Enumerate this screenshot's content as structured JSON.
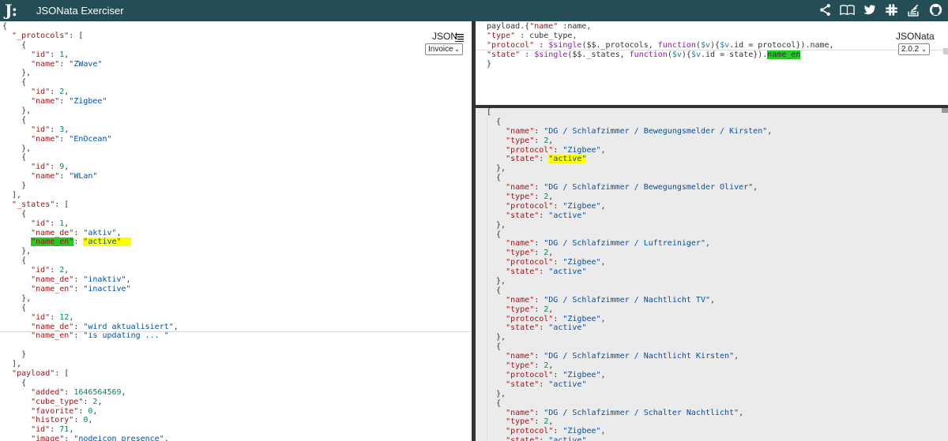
{
  "app": {
    "logo_glyph": "J:",
    "title": "JSONata Exerciser",
    "icons": [
      "share-icon",
      "book-icon",
      "twitter-icon",
      "slack-icon",
      "stackoverflow-icon",
      "github-icon"
    ]
  },
  "input_pane": {
    "label": "JSON",
    "selector": {
      "selected": "Invoice"
    }
  },
  "expression_pane": {
    "label": "JSONata",
    "version_selector": {
      "selected": "2.0.2"
    }
  },
  "input_lines": [
    [
      [
        "p",
        "{"
      ]
    ],
    [
      [
        "p",
        "  "
      ],
      [
        "k",
        "\"_protocols\""
      ],
      [
        "p",
        ": ["
      ]
    ],
    [
      [
        "p",
        "    {"
      ]
    ],
    [
      [
        "p",
        "      "
      ],
      [
        "k",
        "\"id\""
      ],
      [
        "p",
        ": "
      ],
      [
        "n",
        "1"
      ],
      [
        "p",
        ","
      ]
    ],
    [
      [
        "p",
        "      "
      ],
      [
        "k",
        "\"name\""
      ],
      [
        "p",
        ": "
      ],
      [
        "s",
        "\"ZWave\""
      ]
    ],
    [
      [
        "p",
        "    },"
      ]
    ],
    [
      [
        "p",
        "    {"
      ]
    ],
    [
      [
        "p",
        "      "
      ],
      [
        "k",
        "\"id\""
      ],
      [
        "p",
        ": "
      ],
      [
        "n",
        "2"
      ],
      [
        "p",
        ","
      ]
    ],
    [
      [
        "p",
        "      "
      ],
      [
        "k",
        "\"name\""
      ],
      [
        "p",
        ": "
      ],
      [
        "s",
        "\"Zigbee\""
      ]
    ],
    [
      [
        "p",
        "    },"
      ]
    ],
    [
      [
        "p",
        "    {"
      ]
    ],
    [
      [
        "p",
        "      "
      ],
      [
        "k",
        "\"id\""
      ],
      [
        "p",
        ": "
      ],
      [
        "n",
        "3"
      ],
      [
        "p",
        ","
      ]
    ],
    [
      [
        "p",
        "      "
      ],
      [
        "k",
        "\"name\""
      ],
      [
        "p",
        ": "
      ],
      [
        "s",
        "\"EnOcean\""
      ]
    ],
    [
      [
        "p",
        "    },"
      ]
    ],
    [
      [
        "p",
        "    {"
      ]
    ],
    [
      [
        "p",
        "      "
      ],
      [
        "k",
        "\"id\""
      ],
      [
        "p",
        ": "
      ],
      [
        "n",
        "9"
      ],
      [
        "p",
        ","
      ]
    ],
    [
      [
        "p",
        "      "
      ],
      [
        "k",
        "\"name\""
      ],
      [
        "p",
        ": "
      ],
      [
        "s",
        "\"WLan\""
      ]
    ],
    [
      [
        "p",
        "    }"
      ]
    ],
    [
      [
        "p",
        "  ],"
      ]
    ],
    [
      [
        "p",
        "  "
      ],
      [
        "k",
        "\"_states\""
      ],
      [
        "p",
        ": ["
      ]
    ],
    [
      [
        "p",
        "    {"
      ]
    ],
    [
      [
        "p",
        "      "
      ],
      [
        "k",
        "\"id\""
      ],
      [
        "p",
        ": "
      ],
      [
        "n",
        "1"
      ],
      [
        "p",
        ","
      ]
    ],
    [
      [
        "p",
        "      "
      ],
      [
        "k",
        "\"name_de\""
      ],
      [
        "p",
        ": "
      ],
      [
        "s",
        "\"aktiv\""
      ],
      [
        "p",
        ","
      ]
    ],
    [
      [
        "p",
        "      "
      ],
      [
        "k hl-g",
        "\"name_en\""
      ],
      [
        "p",
        ": "
      ],
      [
        "s hl-y",
        "\"active\"  "
      ]
    ],
    [
      [
        "p",
        "    },"
      ]
    ],
    [
      [
        "p",
        "    {"
      ]
    ],
    [
      [
        "p",
        "      "
      ],
      [
        "k",
        "\"id\""
      ],
      [
        "p",
        ": "
      ],
      [
        "n",
        "2"
      ],
      [
        "p",
        ","
      ]
    ],
    [
      [
        "p",
        "      "
      ],
      [
        "k",
        "\"name_de\""
      ],
      [
        "p",
        ": "
      ],
      [
        "s",
        "\"inaktiv\""
      ],
      [
        "p",
        ","
      ]
    ],
    [
      [
        "p",
        "      "
      ],
      [
        "k",
        "\"name_en\""
      ],
      [
        "p",
        ": "
      ],
      [
        "s",
        "\"inactive\""
      ]
    ],
    [
      [
        "p",
        "    },"
      ]
    ],
    [
      [
        "p",
        "    {"
      ]
    ],
    [
      [
        "p",
        "      "
      ],
      [
        "k",
        "\"id\""
      ],
      [
        "p",
        ": "
      ],
      [
        "n",
        "12"
      ],
      [
        "p",
        ","
      ]
    ],
    [
      [
        "p",
        "      "
      ],
      [
        "k",
        "\"name_de\""
      ],
      [
        "p",
        ": "
      ],
      [
        "s",
        "\"wird aktualisiert\""
      ],
      [
        "p",
        ","
      ]
    ],
    [
      [
        "p",
        "      "
      ],
      [
        "k",
        "\"name_en\""
      ],
      [
        "p",
        ": "
      ],
      [
        "s",
        "\"is updating ... \""
      ]
    ],
    [
      [
        "p",
        " "
      ]
    ],
    [
      [
        "p",
        "    }"
      ]
    ],
    [
      [
        "p",
        "  ],"
      ]
    ],
    [
      [
        "p",
        "  "
      ],
      [
        "k",
        "\"payload\""
      ],
      [
        "p",
        ": ["
      ]
    ],
    [
      [
        "p",
        "    {"
      ]
    ],
    [
      [
        "p",
        "      "
      ],
      [
        "k",
        "\"added\""
      ],
      [
        "p",
        ": "
      ],
      [
        "n",
        "1646564569"
      ],
      [
        "p",
        ","
      ]
    ],
    [
      [
        "p",
        "      "
      ],
      [
        "k",
        "\"cube_type\""
      ],
      [
        "p",
        ": "
      ],
      [
        "n",
        "2"
      ],
      [
        "p",
        ","
      ]
    ],
    [
      [
        "p",
        "      "
      ],
      [
        "k",
        "\"favorite\""
      ],
      [
        "p",
        ": "
      ],
      [
        "n",
        "0"
      ],
      [
        "p",
        ","
      ]
    ],
    [
      [
        "p",
        "      "
      ],
      [
        "k",
        "\"history\""
      ],
      [
        "p",
        ": "
      ],
      [
        "n",
        "0"
      ],
      [
        "p",
        ","
      ]
    ],
    [
      [
        "p",
        "      "
      ],
      [
        "k",
        "\"id\""
      ],
      [
        "p",
        ": "
      ],
      [
        "n",
        "71"
      ],
      [
        "p",
        ","
      ]
    ],
    [
      [
        "p",
        "      "
      ],
      [
        "k",
        "\"image\""
      ],
      [
        "p",
        ": "
      ],
      [
        "s",
        "\"nodeicon_presence\""
      ],
      [
        "p",
        ","
      ]
    ]
  ],
  "expression_lines": [
    [
      [
        "p",
        "payload.{"
      ],
      [
        "k",
        "\"name\""
      ],
      [
        "p",
        " :name,"
      ]
    ],
    [
      [
        "k",
        "\"type\""
      ],
      [
        "p",
        " : cube_type,"
      ]
    ],
    [
      [
        "k",
        "\"protocol\""
      ],
      [
        "p",
        " : "
      ],
      [
        "f",
        "$single"
      ],
      [
        "p",
        "($$._protocols, "
      ],
      [
        "f",
        "function"
      ],
      [
        "p",
        "("
      ],
      [
        "v",
        "$v"
      ],
      [
        "p",
        "){"
      ],
      [
        "v",
        "$v"
      ],
      [
        "p",
        ".id = protocol}).name,"
      ]
    ],
    [
      [
        "k",
        "\"state\""
      ],
      [
        "p",
        " : "
      ],
      [
        "f",
        "$single"
      ],
      [
        "p",
        "($$._states, "
      ],
      [
        "f",
        "function"
      ],
      [
        "p",
        "("
      ],
      [
        "v",
        "$v"
      ],
      [
        "p",
        "){"
      ],
      [
        "v",
        "$v"
      ],
      [
        "p",
        ".id = state})."
      ],
      [
        "p hl-g",
        "name_en"
      ],
      [
        "p",
        "  "
      ]
    ],
    [
      [
        "p",
        "}"
      ]
    ]
  ],
  "result_lines": [
    [
      [
        "p",
        "["
      ]
    ],
    [
      [
        "p",
        "  {"
      ]
    ],
    [
      [
        "p",
        "    "
      ],
      [
        "k",
        "\"name\""
      ],
      [
        "p",
        ": "
      ],
      [
        "s",
        "\"DG / Schlafzimmer / Bewegungsmelder / Kirsten\""
      ],
      [
        "p",
        ","
      ]
    ],
    [
      [
        "p",
        "    "
      ],
      [
        "k",
        "\"type\""
      ],
      [
        "p",
        ": "
      ],
      [
        "n",
        "2"
      ],
      [
        "p",
        ","
      ]
    ],
    [
      [
        "p",
        "    "
      ],
      [
        "k",
        "\"protocol\""
      ],
      [
        "p",
        ": "
      ],
      [
        "s",
        "\"Zigbee\""
      ],
      [
        "p",
        ","
      ]
    ],
    [
      [
        "p",
        "    "
      ],
      [
        "k",
        "\"state\""
      ],
      [
        "p",
        ": "
      ],
      [
        "s hl-y",
        "\"active\""
      ]
    ],
    [
      [
        "p",
        "  },"
      ]
    ],
    [
      [
        "p",
        "  {"
      ]
    ],
    [
      [
        "p",
        "    "
      ],
      [
        "k",
        "\"name\""
      ],
      [
        "p",
        ": "
      ],
      [
        "s",
        "\"DG / Schlafzimmer / Bewegungsmelder Oliver\""
      ],
      [
        "p",
        ","
      ]
    ],
    [
      [
        "p",
        "    "
      ],
      [
        "k",
        "\"type\""
      ],
      [
        "p",
        ": "
      ],
      [
        "n",
        "2"
      ],
      [
        "p",
        ","
      ]
    ],
    [
      [
        "p",
        "    "
      ],
      [
        "k",
        "\"protocol\""
      ],
      [
        "p",
        ": "
      ],
      [
        "s",
        "\"Zigbee\""
      ],
      [
        "p",
        ","
      ]
    ],
    [
      [
        "p",
        "    "
      ],
      [
        "k",
        "\"state\""
      ],
      [
        "p",
        ": "
      ],
      [
        "s",
        "\"active\""
      ]
    ],
    [
      [
        "p",
        "  },"
      ]
    ],
    [
      [
        "p",
        "  {"
      ]
    ],
    [
      [
        "p",
        "    "
      ],
      [
        "k",
        "\"name\""
      ],
      [
        "p",
        ": "
      ],
      [
        "s",
        "\"DG / Schlafzimmer / Luftreiniger\""
      ],
      [
        "p",
        ","
      ]
    ],
    [
      [
        "p",
        "    "
      ],
      [
        "k",
        "\"type\""
      ],
      [
        "p",
        ": "
      ],
      [
        "n",
        "2"
      ],
      [
        "p",
        ","
      ]
    ],
    [
      [
        "p",
        "    "
      ],
      [
        "k",
        "\"protocol\""
      ],
      [
        "p",
        ": "
      ],
      [
        "s",
        "\"Zigbee\""
      ],
      [
        "p",
        ","
      ]
    ],
    [
      [
        "p",
        "    "
      ],
      [
        "k",
        "\"state\""
      ],
      [
        "p",
        ": "
      ],
      [
        "s",
        "\"active\""
      ]
    ],
    [
      [
        "p",
        "  },"
      ]
    ],
    [
      [
        "p",
        "  {"
      ]
    ],
    [
      [
        "p",
        "    "
      ],
      [
        "k",
        "\"name\""
      ],
      [
        "p",
        ": "
      ],
      [
        "s",
        "\"DG / Schlafzimmer / Nachtlicht TV\""
      ],
      [
        "p",
        ","
      ]
    ],
    [
      [
        "p",
        "    "
      ],
      [
        "k",
        "\"type\""
      ],
      [
        "p",
        ": "
      ],
      [
        "n",
        "2"
      ],
      [
        "p",
        ","
      ]
    ],
    [
      [
        "p",
        "    "
      ],
      [
        "k",
        "\"protocol\""
      ],
      [
        "p",
        ": "
      ],
      [
        "s",
        "\"Zigbee\""
      ],
      [
        "p",
        ","
      ]
    ],
    [
      [
        "p",
        "    "
      ],
      [
        "k",
        "\"state\""
      ],
      [
        "p",
        ": "
      ],
      [
        "s",
        "\"active\""
      ]
    ],
    [
      [
        "p",
        "  },"
      ]
    ],
    [
      [
        "p",
        "  {"
      ]
    ],
    [
      [
        "p",
        "    "
      ],
      [
        "k",
        "\"name\""
      ],
      [
        "p",
        ": "
      ],
      [
        "s",
        "\"DG / Schlafzimmer / Nachtlicht Kirsten\""
      ],
      [
        "p",
        ","
      ]
    ],
    [
      [
        "p",
        "    "
      ],
      [
        "k",
        "\"type\""
      ],
      [
        "p",
        ": "
      ],
      [
        "n",
        "2"
      ],
      [
        "p",
        ","
      ]
    ],
    [
      [
        "p",
        "    "
      ],
      [
        "k",
        "\"protocol\""
      ],
      [
        "p",
        ": "
      ],
      [
        "s",
        "\"Zigbee\""
      ],
      [
        "p",
        ","
      ]
    ],
    [
      [
        "p",
        "    "
      ],
      [
        "k",
        "\"state\""
      ],
      [
        "p",
        ": "
      ],
      [
        "s",
        "\"active\""
      ]
    ],
    [
      [
        "p",
        "  },"
      ]
    ],
    [
      [
        "p",
        "  {"
      ]
    ],
    [
      [
        "p",
        "    "
      ],
      [
        "k",
        "\"name\""
      ],
      [
        "p",
        ": "
      ],
      [
        "s",
        "\"DG / Schlafzimmer / Schalter Nachtlicht\""
      ],
      [
        "p",
        ","
      ]
    ],
    [
      [
        "p",
        "    "
      ],
      [
        "k",
        "\"type\""
      ],
      [
        "p",
        ": "
      ],
      [
        "n",
        "2"
      ],
      [
        "p",
        ","
      ]
    ],
    [
      [
        "p",
        "    "
      ],
      [
        "k",
        "\"protocol\""
      ],
      [
        "p",
        ": "
      ],
      [
        "s",
        "\"Zigbee\""
      ],
      [
        "p",
        ","
      ]
    ],
    [
      [
        "p",
        "    "
      ],
      [
        "k",
        "\"state\""
      ],
      [
        "p",
        ": "
      ],
      [
        "s",
        "\"active\""
      ]
    ]
  ]
}
